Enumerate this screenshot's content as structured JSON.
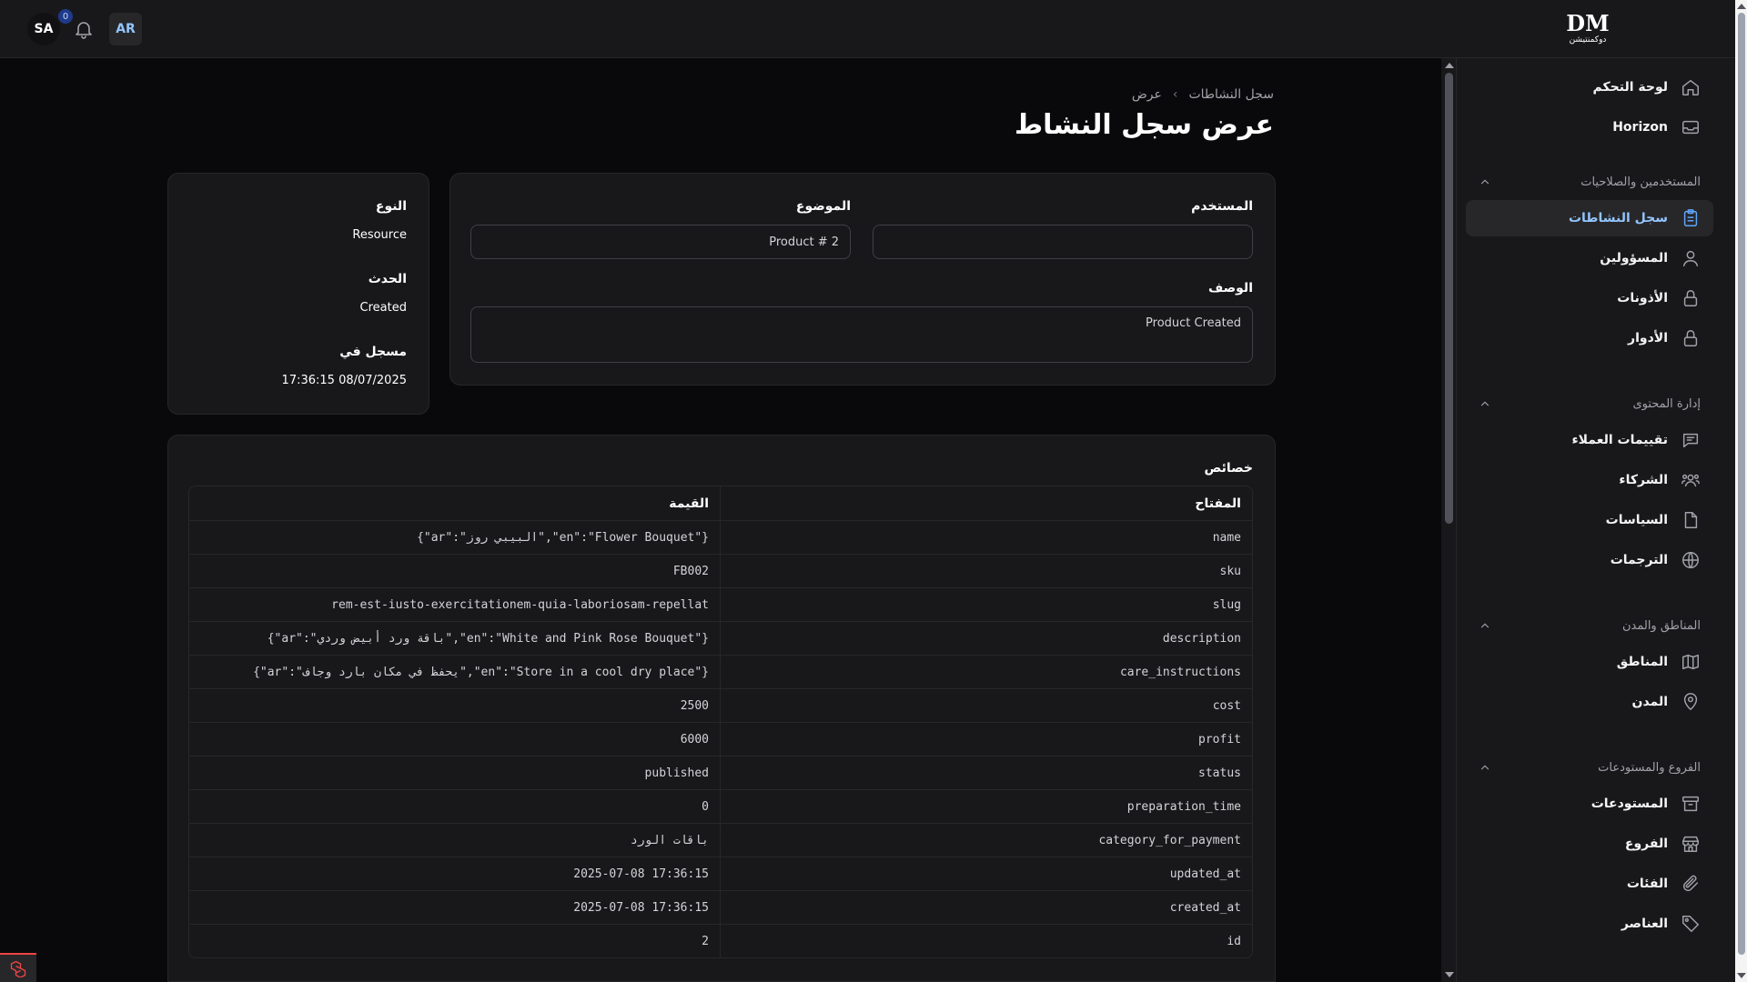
{
  "topbar": {
    "user_initials": "SA",
    "notifications_count": "0",
    "language": "AR",
    "logo_mark": "DM",
    "logo_text": "دوكمنتيشن"
  },
  "breadcrumb": {
    "parent": "سجل النشاطات",
    "current": "عرض"
  },
  "page_title": "عرض سجل النشاط",
  "main_card": {
    "user_label": "المستخدم",
    "user_value": "",
    "subject_label": "الموضوع",
    "subject_value": "Product # 2",
    "description_label": "الوصف",
    "description_value": "Product Created"
  },
  "side_card": {
    "type_label": "النوع",
    "type_value": "Resource",
    "event_label": "الحدث",
    "event_value": "Created",
    "logged_at_label": "مسجل في",
    "logged_at_value": "17:36:15 08/07/2025"
  },
  "properties": {
    "title": "خصائص",
    "key_header": "المفتاح",
    "value_header": "القيمة",
    "rows": [
      {
        "key": "name",
        "value": "{\"ar\":\"البيبي روز\",\"en\":\"Flower Bouquet\"}"
      },
      {
        "key": "sku",
        "value": "FB002"
      },
      {
        "key": "slug",
        "value": "rem-est-iusto-exercitationem-quia-laboriosam-repellat"
      },
      {
        "key": "description",
        "value": "{\"ar\":\"باقة ورد أبيض وردي\",\"en\":\"White and Pink Rose Bouquet\"}"
      },
      {
        "key": "care_instructions",
        "value": "{\"ar\":\"يحفظ في مكان بارد وجاف\",\"en\":\"Store in a cool dry place\"}"
      },
      {
        "key": "cost",
        "value": "2500"
      },
      {
        "key": "profit",
        "value": "6000"
      },
      {
        "key": "status",
        "value": "published"
      },
      {
        "key": "preparation_time",
        "value": "0"
      },
      {
        "key": "category_for_payment",
        "value": "باقات الورد"
      },
      {
        "key": "updated_at",
        "value": "2025-07-08 17:36:15"
      },
      {
        "key": "created_at",
        "value": "2025-07-08 17:36:15"
      },
      {
        "key": "id",
        "value": "2"
      }
    ]
  },
  "sidebar": {
    "items": [
      {
        "label": "لوحة التحكم",
        "icon": "home-icon"
      },
      {
        "label": "Horizon",
        "icon": "inbox-icon"
      }
    ],
    "groups": [
      {
        "label": "المستخدمين والصلاحيات",
        "items": [
          {
            "label": "سجل النشاطات",
            "icon": "clipboard-icon",
            "active": true
          },
          {
            "label": "المسؤولين",
            "icon": "user-icon"
          },
          {
            "label": "الأذونات",
            "icon": "lock-icon"
          },
          {
            "label": "الأدوار",
            "icon": "lock-icon"
          }
        ]
      },
      {
        "label": "إدارة المحتوى",
        "items": [
          {
            "label": "تقييمات العملاء",
            "icon": "chat-icon"
          },
          {
            "label": "الشركاء",
            "icon": "users-icon"
          },
          {
            "label": "السياسات",
            "icon": "document-icon"
          },
          {
            "label": "الترجمات",
            "icon": "globe-icon"
          }
        ]
      },
      {
        "label": "المناطق والمدن",
        "items": [
          {
            "label": "المناطق",
            "icon": "map-icon"
          },
          {
            "label": "المدن",
            "icon": "map-pin-icon"
          }
        ]
      },
      {
        "label": "الفروع والمستودعات",
        "items": [
          {
            "label": "المستودعات",
            "icon": "archive-box-icon"
          },
          {
            "label": "الفروع",
            "icon": "storefront-icon"
          },
          {
            "label": "الفئات",
            "icon": "paperclip-icon"
          },
          {
            "label": "العناصر",
            "icon": "tag-icon"
          }
        ]
      }
    ]
  },
  "colors": {
    "background": "#09090b",
    "surface": "#18181b",
    "border": "#27272a",
    "accent": "#60a5fa"
  }
}
